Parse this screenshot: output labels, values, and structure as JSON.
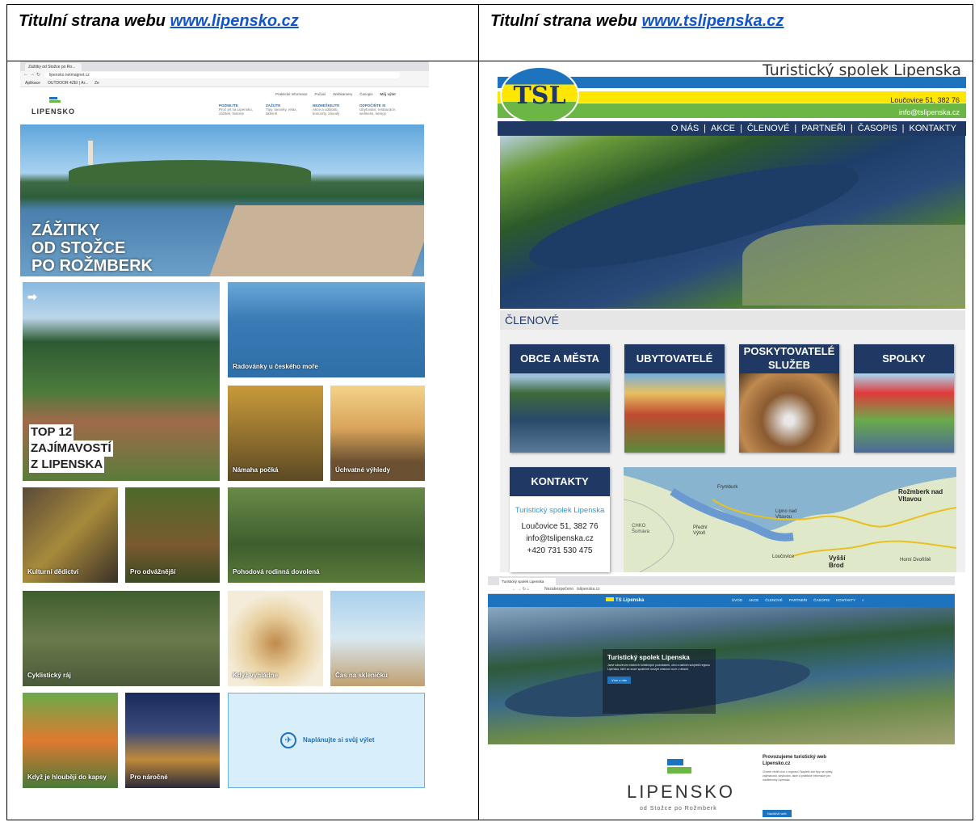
{
  "headers": {
    "left_prefix": "Titulní strana webu ",
    "left_link": "www.lipensko.cz",
    "right_prefix": "Titulní strana webu ",
    "right_link": "www.tslipenska.cz"
  },
  "lipensko": {
    "browser_tab": "Zážitky od Stožce po Ro...",
    "url": "lipensko.netmagnet.cz",
    "bookmarks": [
      "Aplikace",
      "OUTDOOR 4ZEI | Ar...",
      "Ze"
    ],
    "logo_text": "LIPENSKO",
    "top_links": [
      "Praktické informace",
      "Počasí",
      "Webkamery",
      "Časopis",
      "Můj výlet"
    ],
    "menu": [
      {
        "title": "POZNEJTE",
        "sub": "Proč jet na Lipensko, zážitek, historie"
      },
      {
        "title": "ZAŽIJTE",
        "sub": "Tipy, lanovky, relax, aktivně"
      },
      {
        "title": "NEZMEŠKEJTE",
        "sub": "Akce a události, koncerty, závody"
      },
      {
        "title": "ODPOČIŇTE SI",
        "sub": "Ubytování, restaurace, wellness, kempy"
      }
    ],
    "hero": [
      "ZÁŽITKY",
      "OD STOŽCE",
      "PO ROŽMBERK"
    ],
    "top12": [
      "TOP 12",
      "ZAJÍMAVOSTÍ",
      "Z LIPENSKA"
    ],
    "tiles": [
      "Radovánky u českého moře",
      "Námaha počká",
      "Úchvatné výhledy",
      "Kulturní dědictví",
      "Pro odvážnější",
      "Pohodová rodinná dovolená",
      "Cyklistický ráj",
      "Když vyhládne",
      "Čas na skleničku",
      "Když je hlouběji do kapsy",
      "Pro náročné",
      "Naplánujte si svůj výlet"
    ]
  },
  "tsl": {
    "title": "Turistický spolek Lipenska",
    "logo": "TSL",
    "address": "Loučovice 51, 382 76",
    "email": "info@tslipenska.cz",
    "nav": [
      "O NÁS",
      "AKCE",
      "ČLENOVÉ",
      "PARTNEŘI",
      "ČASOPIS",
      "KONTAKTY"
    ],
    "section": "ČLENOVÉ",
    "boxes": [
      "OBCE A MĚSTA",
      "UBYTOVATELÉ",
      "POSKYTOVATELÉ SLUŽEB",
      "SPOLKY"
    ],
    "contact": {
      "heading": "KONTAKTY",
      "name": "Turistický spolek Lipenska",
      "address": "Loučovice 51, 382 76",
      "email": "info@tslipenska.cz",
      "phone": "+420 731 530 475"
    },
    "map_labels": [
      "Rožmberk nad Vltavou",
      "Frymburk",
      "Lipno nad Vltavou",
      "Přední Výtoň",
      "CHKO Šumava",
      "Loučovice",
      "Vyšší Brod",
      "Horní Dvořiště"
    ]
  },
  "tsl_new": {
    "tab": "Turistický spolek Lipenska",
    "url": "tslipenska.cz",
    "url_prefix": "Nezabezpečeno",
    "logo": "TS Lipenska",
    "nav": [
      "ÚVOD",
      "AKCE",
      "ČLENOVÉ",
      "PARTNEŘI",
      "ČASOPIS",
      "KONTAKTY"
    ],
    "hero_title": "Turistický spolek Lipenska",
    "hero_text": "Jsme sdružením místních turistických podnikatelů, obcí a dalších subjektů regionu Lipenska, kteří se snaží společně rozvíjet cestovní ruch v oblasti.",
    "hero_button": "Více o nás",
    "brand": "LIPENSKO",
    "brand_sub": "od Stožce po Rožmberk",
    "promo_title": "Provozujeme turistický web Lipensko.cz",
    "promo_text": "Chcete vědět více o regionu? Najdete zde tipy na výlety, zajímavosti, ubytování, akce a praktické informace pro návštěvníky Lipenska.",
    "promo_button": "Navštívit web"
  },
  "colors": {
    "link": "#1155cc",
    "navy": "#1f3864",
    "tsl_blue": "#1e73be",
    "yellow": "#ffe600",
    "green": "#6bb644"
  }
}
